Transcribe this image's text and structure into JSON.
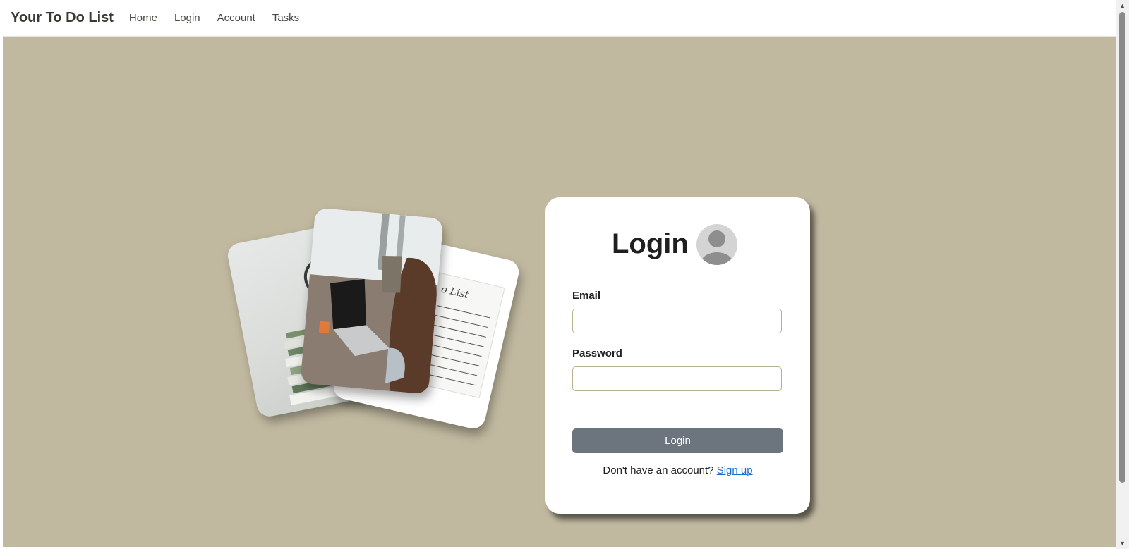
{
  "navbar": {
    "brand": "Your To Do List",
    "links": [
      "Home",
      "Login",
      "Account",
      "Tasks"
    ]
  },
  "login": {
    "title": "Login",
    "email_label": "Email",
    "email_value": "",
    "password_label": "Password",
    "password_value": "",
    "button_label": "Login",
    "signup_prompt": "Don't have an account?",
    "signup_link": "Sign up"
  },
  "colors": {
    "background": "#c0b89f",
    "button": "#6c757d",
    "link": "#1a6fcf",
    "input_border": "#b7b091"
  }
}
